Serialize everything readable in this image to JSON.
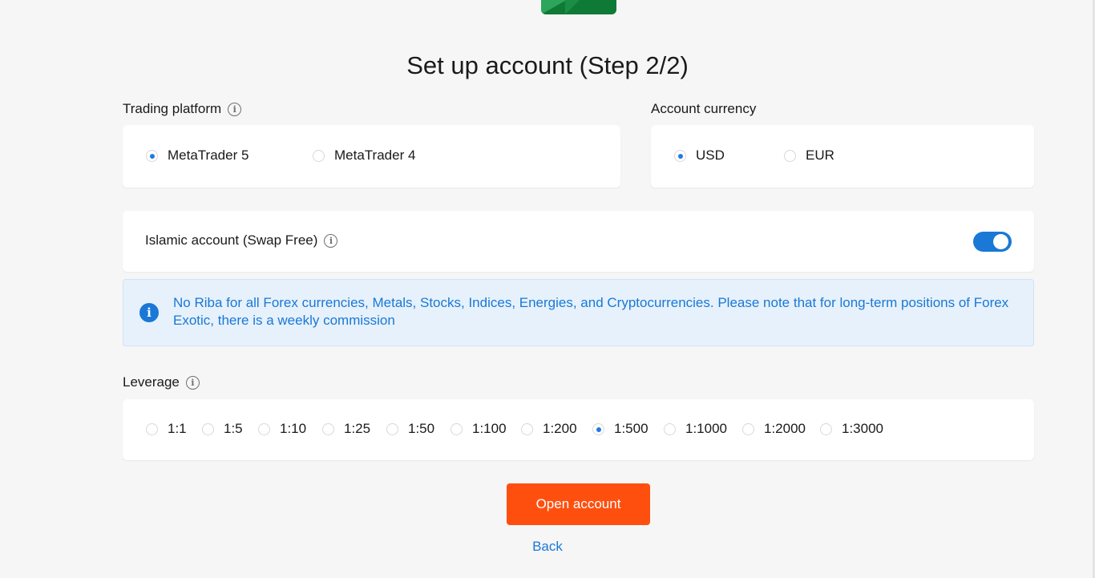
{
  "page": {
    "title": "Set up account (Step 2/2)"
  },
  "trading_platform": {
    "label": "Trading platform",
    "options": [
      {
        "label": "MetaTrader 5",
        "checked": true
      },
      {
        "label": "MetaTrader 4",
        "checked": false
      }
    ]
  },
  "account_currency": {
    "label": "Account currency",
    "options": [
      {
        "label": "USD",
        "checked": true
      },
      {
        "label": "EUR",
        "checked": false
      }
    ]
  },
  "islamic": {
    "label": "Islamic account (Swap Free)",
    "enabled": true
  },
  "notice": {
    "text": "No Riba for all Forex currencies, Metals, Stocks, Indices, Energies, and Cryptocurrencies. Please note that for long-term positions of Forex Exotic, there is a weekly commission"
  },
  "leverage": {
    "label": "Leverage",
    "options": [
      {
        "label": "1:1",
        "checked": false
      },
      {
        "label": "1:5",
        "checked": false
      },
      {
        "label": "1:10",
        "checked": false
      },
      {
        "label": "1:25",
        "checked": false
      },
      {
        "label": "1:50",
        "checked": false
      },
      {
        "label": "1:100",
        "checked": false
      },
      {
        "label": "1:200",
        "checked": false
      },
      {
        "label": "1:500",
        "checked": true
      },
      {
        "label": "1:1000",
        "checked": false
      },
      {
        "label": "1:2000",
        "checked": false
      },
      {
        "label": "1:3000",
        "checked": false
      }
    ]
  },
  "actions": {
    "open_label": "Open account",
    "back_label": "Back"
  },
  "icons": {
    "info": "info-icon",
    "notice": "info-circle-icon",
    "logo": "brand-logo"
  },
  "colors": {
    "accent": "#1a78d6",
    "primary_button": "#ff4f0f",
    "notice_bg": "#e6f1fb",
    "logo": "#0f7a35"
  }
}
